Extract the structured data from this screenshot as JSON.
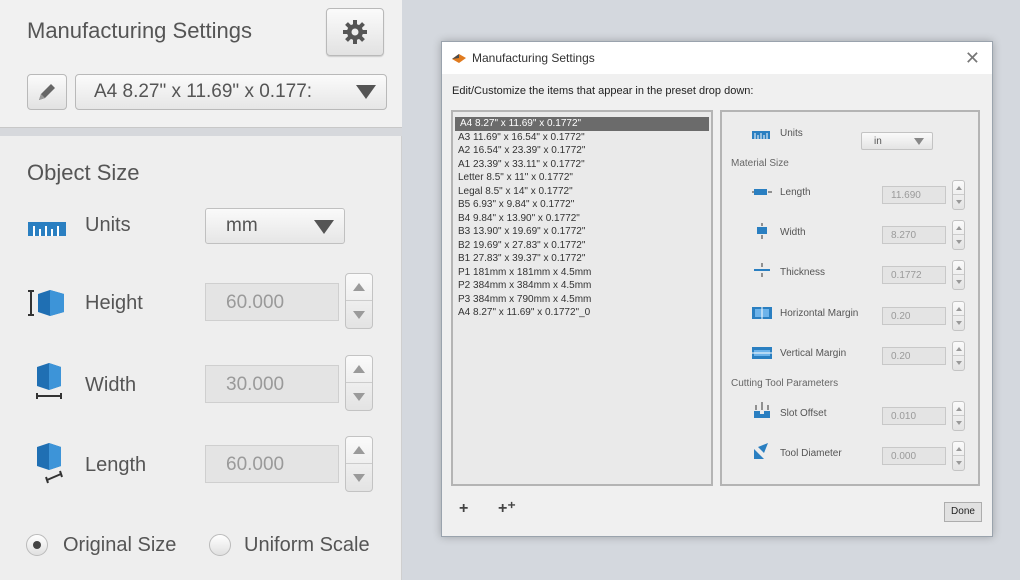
{
  "left_panel": {
    "title": "Manufacturing Settings",
    "preset_value": "A4 8.27\" x 11.69\" x 0.177:",
    "object_size": {
      "title": "Object Size",
      "units_label": "Units",
      "units_value": "mm",
      "height_label": "Height",
      "height_value": "60.000",
      "width_label": "Width",
      "width_value": "30.000",
      "length_label": "Length",
      "length_value": "60.000"
    },
    "original_size_label": "Original Size",
    "uniform_scale_label": "Uniform Scale",
    "selected_radio": "Original Size"
  },
  "dialog": {
    "title": "Manufacturing Settings",
    "subtitle": "Edit/Customize the items that appear in the preset drop down:",
    "presets": [
      "A4 8.27\" x 11.69\" x 0.1772\"",
      "A3 11.69\" x 16.54\" x 0.1772\"",
      "A2 16.54\" x 23.39\" x 0.1772\"",
      "A1 23.39\" x 33.11\" x 0.1772\"",
      "Letter 8.5\" x 11\" x 0.1772\"",
      "Legal 8.5\" x 14\" x 0.1772\"",
      "B5 6.93\" x 9.84\" x 0.1772\"",
      "B4 9.84\" x 13.90\" x 0.1772\"",
      "B3 13.90\" x 19.69\" x 0.1772\"",
      "B2 19.69\" x 27.83\" x 0.1772\"",
      "B1 27.83\" x 39.37\" x 0.1772\"",
      "P1 181mm x 181mm x 4.5mm",
      "P2 384mm x 384mm x 4.5mm",
      "P3 384mm x 790mm x 4.5mm",
      "A4 8.27\" x 11.69\" x 0.1772\"_0"
    ],
    "selected_preset_index": 0,
    "units_label": "Units",
    "units_value": "in",
    "material_size_label": "Material Size",
    "length_label": "Length",
    "length_value": "11.690",
    "width_label": "Width",
    "width_value": "8.270",
    "thickness_label": "Thickness",
    "thickness_value": "0.1772",
    "hmargin_label": "Horizontal Margin",
    "hmargin_value": "0.20",
    "vmargin_label": "Vertical Margin",
    "vmargin_value": "0.20",
    "cutting_label": "Cutting Tool Parameters",
    "slot_label": "Slot Offset",
    "slot_value": "0.010",
    "tool_label": "Tool Diameter",
    "tool_value": "0.000",
    "close_glyph": "✕",
    "add_glyph": "+",
    "add_copy_glyph": "+⁺",
    "done_label": "Done"
  }
}
